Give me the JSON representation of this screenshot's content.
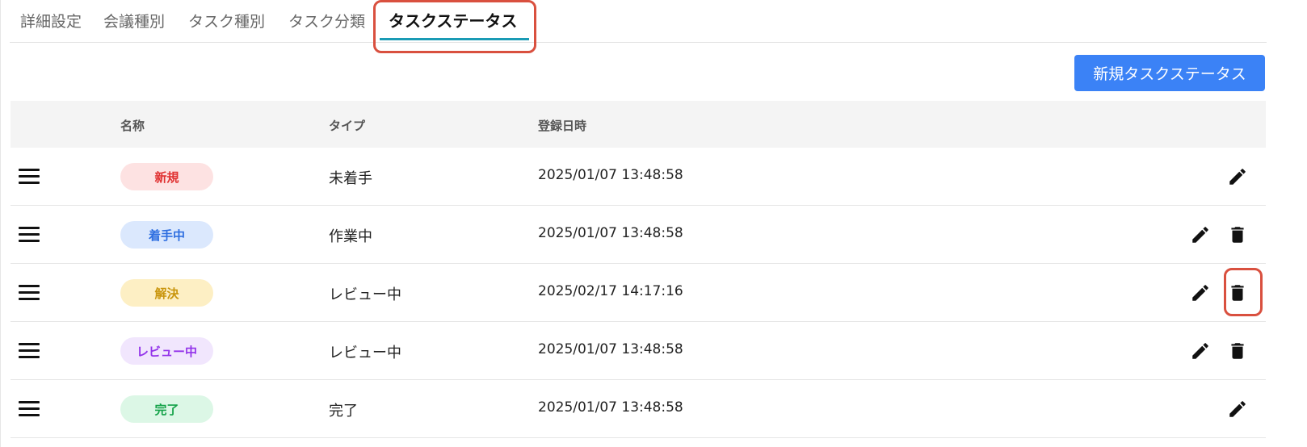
{
  "tabs": [
    {
      "label": "詳細設定"
    },
    {
      "label": "会議種別"
    },
    {
      "label": "タスク種別"
    },
    {
      "label": "タスク分類"
    },
    {
      "label": "タスクステータス",
      "active": true
    }
  ],
  "toolbar": {
    "new_button_label": "新規タスクステータス"
  },
  "table": {
    "headers": {
      "name": "名称",
      "type": "タイプ",
      "created": "登録日時"
    },
    "rows": [
      {
        "name": "新規",
        "type": "未着手",
        "created": "2025/01/07 13:48:58",
        "badge_bg": "#fde2e2",
        "badge_fg": "#e03131",
        "actions": [
          "edit"
        ]
      },
      {
        "name": "着手中",
        "type": "作業中",
        "created": "2025/01/07 13:48:58",
        "badge_bg": "#dbe8fd",
        "badge_fg": "#2f6fe0",
        "actions": [
          "edit",
          "delete"
        ]
      },
      {
        "name": "解決",
        "type": "レビュー中",
        "created": "2025/02/17 14:17:16",
        "badge_bg": "#fdefc4",
        "badge_fg": "#c9950c",
        "actions": [
          "edit",
          "delete"
        ]
      },
      {
        "name": "レビュー中",
        "type": "レビュー中",
        "created": "2025/01/07 13:48:58",
        "badge_bg": "#f1e6fd",
        "badge_fg": "#9333ea",
        "actions": [
          "edit",
          "delete"
        ]
      },
      {
        "name": "完了",
        "type": "完了",
        "created": "2025/01/07 13:48:58",
        "badge_bg": "#dcf7e6",
        "badge_fg": "#16a34a",
        "actions": [
          "edit"
        ]
      }
    ]
  },
  "icons": {
    "drag": "drag-handle-icon",
    "edit": "pencil-icon",
    "delete": "trash-icon"
  },
  "colors": {
    "accent": "#3b82f6",
    "tab_underline": "#1a9bb5",
    "highlight": "#d9503f"
  }
}
